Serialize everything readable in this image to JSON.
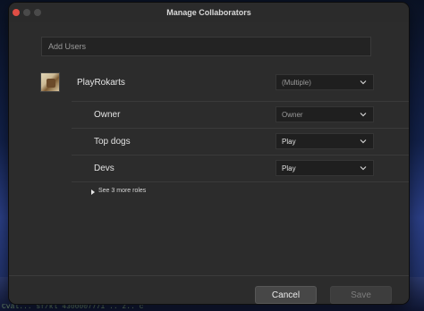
{
  "window": {
    "title": "Manage Collaborators"
  },
  "add_users": {
    "placeholder": "Add Users"
  },
  "user": {
    "name": "PlayRokarts",
    "permission": "(Multiple)",
    "avatar_icon": "user-avatar-image"
  },
  "roles": [
    {
      "label": "Owner",
      "permission": "Owner"
    },
    {
      "label": "Top dogs",
      "permission": "Play"
    },
    {
      "label": "Devs",
      "permission": "Play"
    }
  ],
  "see_more": {
    "label": "See 3 more roles"
  },
  "footer": {
    "cancel_label": "Cancel",
    "save_label": "Save"
  },
  "background_text": "Cval... sf/kl 4300007771 .. z.. c"
}
